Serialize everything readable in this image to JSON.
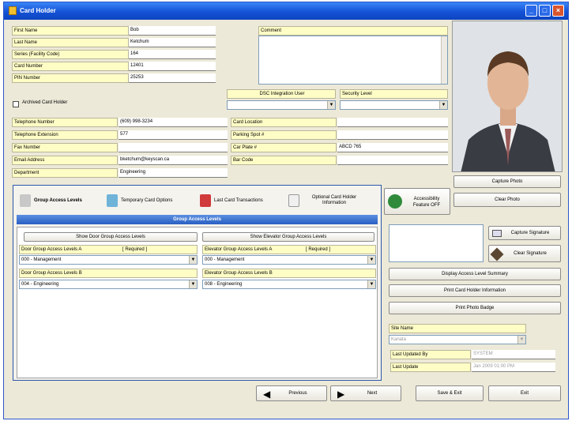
{
  "window": {
    "title": "Card Holder"
  },
  "fields": {
    "first_name": {
      "label": "First Name",
      "value": "Bob"
    },
    "last_name": {
      "label": "Last Name",
      "value": "Ketchum"
    },
    "facility_code": {
      "label": "Series (Facility Code)",
      "value": "164"
    },
    "card_number": {
      "label": "Card Number",
      "value": "12401"
    },
    "pin_number": {
      "label": "PIN Number",
      "value": "25253"
    },
    "archived": {
      "label": "Archived Card Holder"
    },
    "comment": {
      "label": "Comment",
      "value": ""
    },
    "dsc_integration": {
      "label": "DSC Integration User",
      "value": ""
    },
    "security_level": {
      "label": "Security Level",
      "value": ""
    },
    "telephone_number": {
      "label": "Telephone Number",
      "value": "(609) 998-3234"
    },
    "telephone_extension": {
      "label": "Telephone Extension",
      "value": "577"
    },
    "fax_number": {
      "label": "Fax Number",
      "value": ""
    },
    "email_address": {
      "label": "Email Address",
      "value": "bketchum@keyscan.ca"
    },
    "department": {
      "label": "Department",
      "value": "Engineering"
    },
    "card_location": {
      "label": "Card Location",
      "value": ""
    },
    "parking_spot": {
      "label": "Parking Spot #",
      "value": ""
    },
    "car_plate": {
      "label": "Car Plate #",
      "value": "ABCD 765"
    },
    "bar_code": {
      "label": "Bar Code",
      "value": ""
    }
  },
  "photo_buttons": {
    "capture": "Capture Photo",
    "clear": "Clear Photo"
  },
  "tabs": [
    {
      "label": "Group Access Levels"
    },
    {
      "label": "Temporary Card Options"
    },
    {
      "label": "Last Card Transactions"
    },
    {
      "label": "Optional Card Holder Information"
    }
  ],
  "accessibility": {
    "label": "Accessibility Feature OFF"
  },
  "group_panel": {
    "title": "Group Access Levels",
    "show_door_btn": "Show Door Group Access Levels",
    "show_elevator_btn": "Show Elevator Group Access Levels",
    "door_a": {
      "label": "Door Group Access Levels A",
      "required": "[ Required ]",
      "value": "000 - Management"
    },
    "door_b": {
      "label": "Door Group Access Levels B",
      "value": "004 - Engineering"
    },
    "elev_a": {
      "label": "Elevator Group Access Levels A",
      "required": "[ Required ]",
      "value": "000 - Management"
    },
    "elev_b": {
      "label": "Elevator Group Access Levels B",
      "value": "008 - Engineering"
    }
  },
  "signature": {
    "capture": "Capture Signature",
    "clear": "Clear Signature"
  },
  "right_buttons": {
    "summary": "Display Access Level Summary",
    "print_info": "Print Card Holder Information",
    "print_badge": "Print Photo Badge"
  },
  "site": {
    "label": "Site Name",
    "value": "Kanata",
    "last_updated_by_label": "Last Updated By",
    "last_updated_by_value": "SYSTEM",
    "last_update_label": "Last Update",
    "last_update_value": "Jan 2009 01:00 PM"
  },
  "footer": {
    "previous": "Previous",
    "next": "Next",
    "save_exit": "Save & Exit",
    "exit": "Exit"
  }
}
